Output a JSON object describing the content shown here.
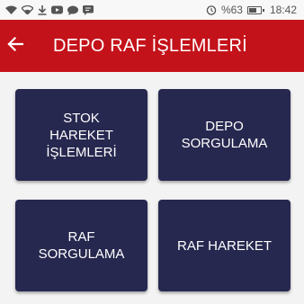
{
  "status_bar": {
    "battery_text": "%63",
    "time": "18:42",
    "left_icons": [
      "wifi-icon",
      "wifi-icon",
      "download-icon",
      "youtube-icon",
      "chat-icon",
      "sms-icon"
    ],
    "right_icons": [
      "alarm-icon",
      "battery-icon"
    ],
    "battery_level": 0.63
  },
  "app_bar": {
    "title": "DEPO RAF İŞLEMLERİ",
    "back_icon": "arrow-left-icon",
    "color": "#c4121a"
  },
  "tiles": [
    {
      "label": "STOK\nHAREKET\nİŞLEMLERİ"
    },
    {
      "label": "DEPO\nSORGULAMA"
    },
    {
      "label": "RAF\nSORGULAMA"
    },
    {
      "label": "RAF HAREKET"
    }
  ],
  "colors": {
    "tile_background": "#27284f",
    "page_background": "#f3f3f3"
  }
}
